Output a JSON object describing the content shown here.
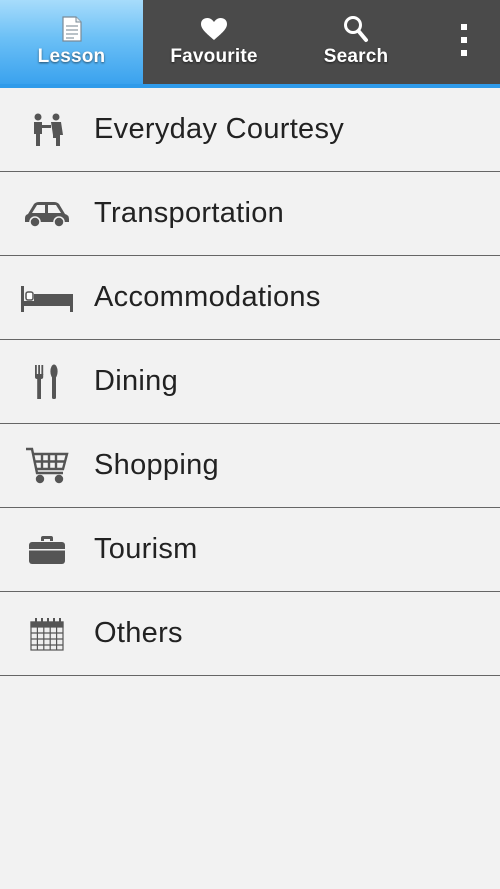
{
  "tabs": {
    "lesson": {
      "label": "Lesson",
      "icon": "document-icon"
    },
    "favourite": {
      "label": "Favourite",
      "icon": "heart-icon"
    },
    "search": {
      "label": "Search",
      "icon": "search-icon"
    },
    "overflow_icon": "more-vert-icon"
  },
  "colors": {
    "accent": "#2f9bea",
    "tabbar": "#4a4a4a",
    "list_bg": "#f2f2f2"
  },
  "lessons": [
    {
      "label": "Everyday Courtesy",
      "icon": "people-icon"
    },
    {
      "label": "Transportation",
      "icon": "car-icon"
    },
    {
      "label": "Accommodations",
      "icon": "bed-icon"
    },
    {
      "label": "Dining",
      "icon": "fork-spoon-icon"
    },
    {
      "label": "Shopping",
      "icon": "cart-icon"
    },
    {
      "label": "Tourism",
      "icon": "briefcase-icon"
    },
    {
      "label": "Others",
      "icon": "calendar-icon"
    }
  ]
}
